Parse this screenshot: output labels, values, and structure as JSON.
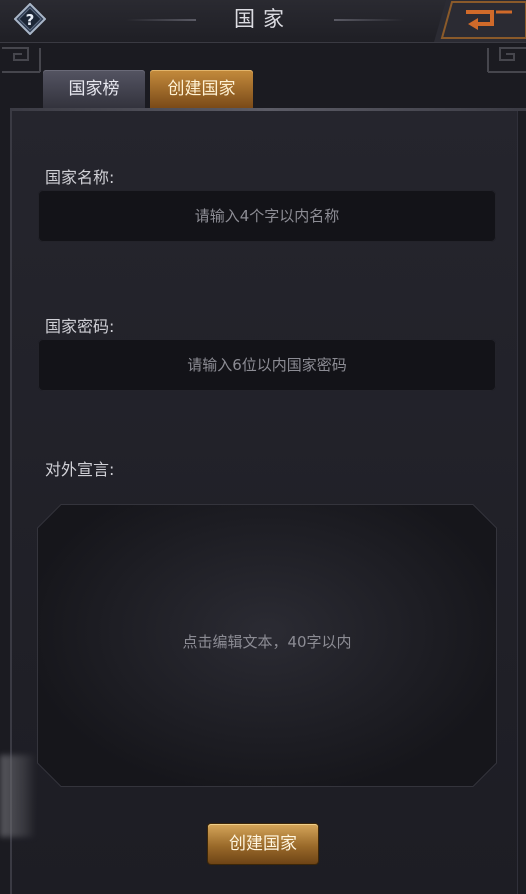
{
  "header": {
    "title": "国家"
  },
  "tabs": [
    {
      "label": "国家榜",
      "active": false
    },
    {
      "label": "创建国家",
      "active": true
    }
  ],
  "form": {
    "name": {
      "label": "国家名称:",
      "placeholder": "请输入4个字以内名称"
    },
    "password": {
      "label": "国家密码:",
      "placeholder": "请输入6位以内国家密码"
    },
    "declaration": {
      "label": "对外宣言:",
      "placeholder": "点击编辑文本，40字以内"
    }
  },
  "create_button": {
    "label": "创建国家"
  },
  "colors": {
    "accent_gold": "#c48b3c",
    "background": "#1b1b21",
    "input_background": "#131318"
  }
}
